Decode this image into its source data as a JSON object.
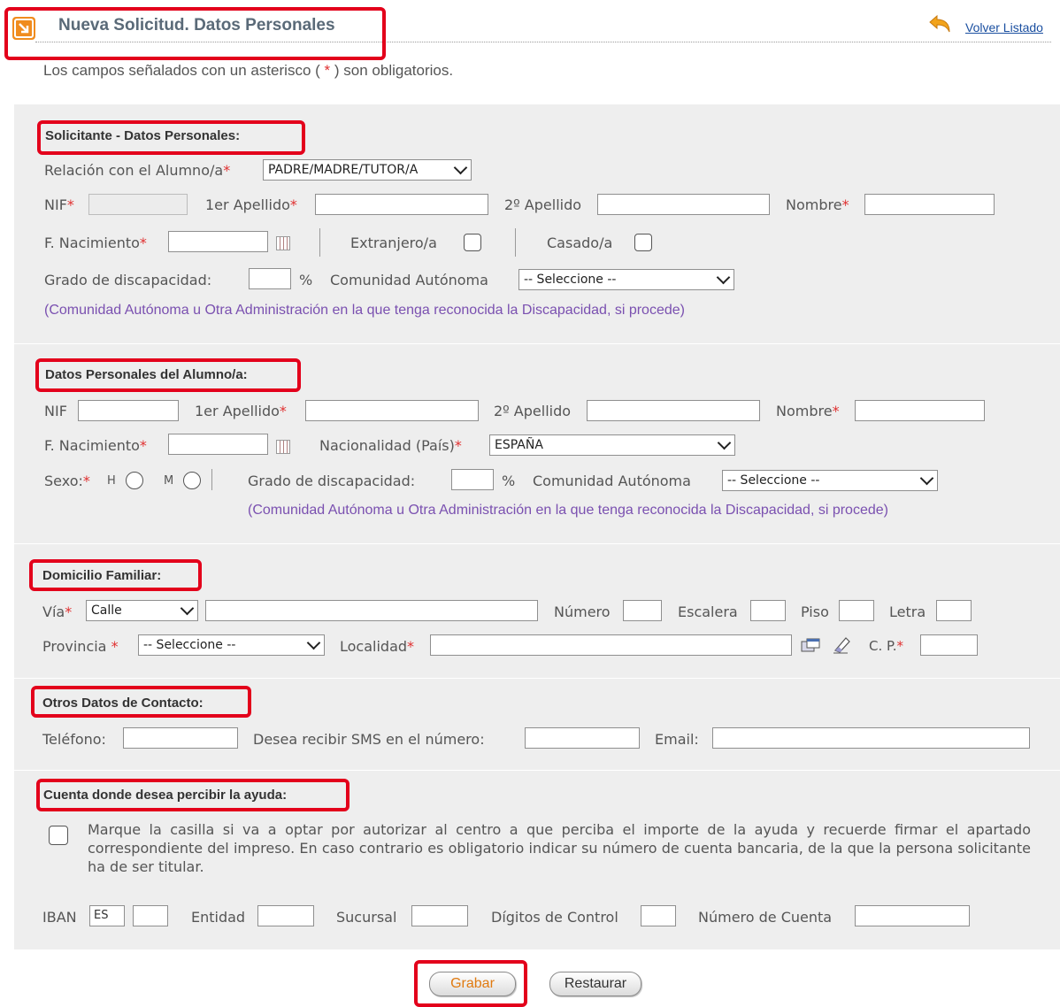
{
  "header": {
    "title": "Nueva Solicitud. Datos Personales",
    "back_link": "Volver Listado",
    "required_note_prefix": "Los campos señalados con un asterisco (",
    "required_note_star": "*",
    "required_note_suffix": ") son obligatorios."
  },
  "solicitante": {
    "heading": "Solicitante - Datos Personales:",
    "relacion_label": "Relación con el Alumno/a",
    "relacion_value": "PADRE/MADRE/TUTOR/A",
    "nif_label": "NIF",
    "apellido1_label": "1er Apellido",
    "apellido2_label": "2º Apellido",
    "nombre_label": "Nombre",
    "nacimiento_label": "F. Nacimiento",
    "extranjero_label": "Extranjero/a",
    "casado_label": "Casado/a",
    "discapacidad_label": "Grado de discapacidad:",
    "percent": "%",
    "comunidad_label": "Comunidad Autónoma",
    "comunidad_value": "-- Seleccione --",
    "comunidad_note": "(Comunidad Autónoma u Otra Administración en la que tenga reconocida la Discapacidad, si procede)"
  },
  "alumno": {
    "heading": "Datos Personales del Alumno/a:",
    "nif_label": "NIF",
    "apellido1_label": "1er Apellido",
    "apellido2_label": "2º Apellido",
    "nombre_label": "Nombre",
    "nacimiento_label": "F. Nacimiento",
    "nacionalidad_label": "Nacionalidad (País)",
    "nacionalidad_value": "ESPAÑA",
    "sexo_label": "Sexo:",
    "sexo_h": "H",
    "sexo_m": "M",
    "discapacidad_label": "Grado de discapacidad:",
    "percent": "%",
    "comunidad_label": "Comunidad Autónoma",
    "comunidad_value": "-- Seleccione --",
    "comunidad_note": "(Comunidad Autónoma u Otra Administración en la que tenga reconocida la Discapacidad, si procede)"
  },
  "domicilio": {
    "heading": "Domicilio Familiar:",
    "via_label": "Vía",
    "via_value": "Calle",
    "numero_label": "Número",
    "escalera_label": "Escalera",
    "piso_label": "Piso",
    "letra_label": "Letra",
    "provincia_label": "Provincia",
    "provincia_value": "-- Seleccione --",
    "localidad_label": "Localidad",
    "cp_label": "C. P."
  },
  "contacto": {
    "heading": "Otros Datos de Contacto:",
    "telefono_label": "Teléfono:",
    "sms_label": "Desea recibir SMS en el número:",
    "email_label": "Email:"
  },
  "cuenta": {
    "heading": "Cuenta donde desea percibir la ayuda:",
    "checkbox_text": "Marque la casilla si va a optar por autorizar al centro a que perciba el importe de la ayuda y recuerde firmar el apartado correspondiente del impreso. En caso contrario es obligatorio indicar su número de cuenta bancaria, de la que la persona solicitante ha de ser titular.",
    "iban_label": "IBAN",
    "iban_value": "ES",
    "entidad_label": "Entidad",
    "sucursal_label": "Sucursal",
    "digitos_label": "Dígitos de Control",
    "numero_label": "Número de Cuenta"
  },
  "buttons": {
    "grabar": "Grabar",
    "restaurar": "Restaurar"
  },
  "colors": {
    "highlight": "#e3001b",
    "section_bg": "#eeeeee",
    "required": "#e03030",
    "note_purple": "#7a50b0"
  }
}
